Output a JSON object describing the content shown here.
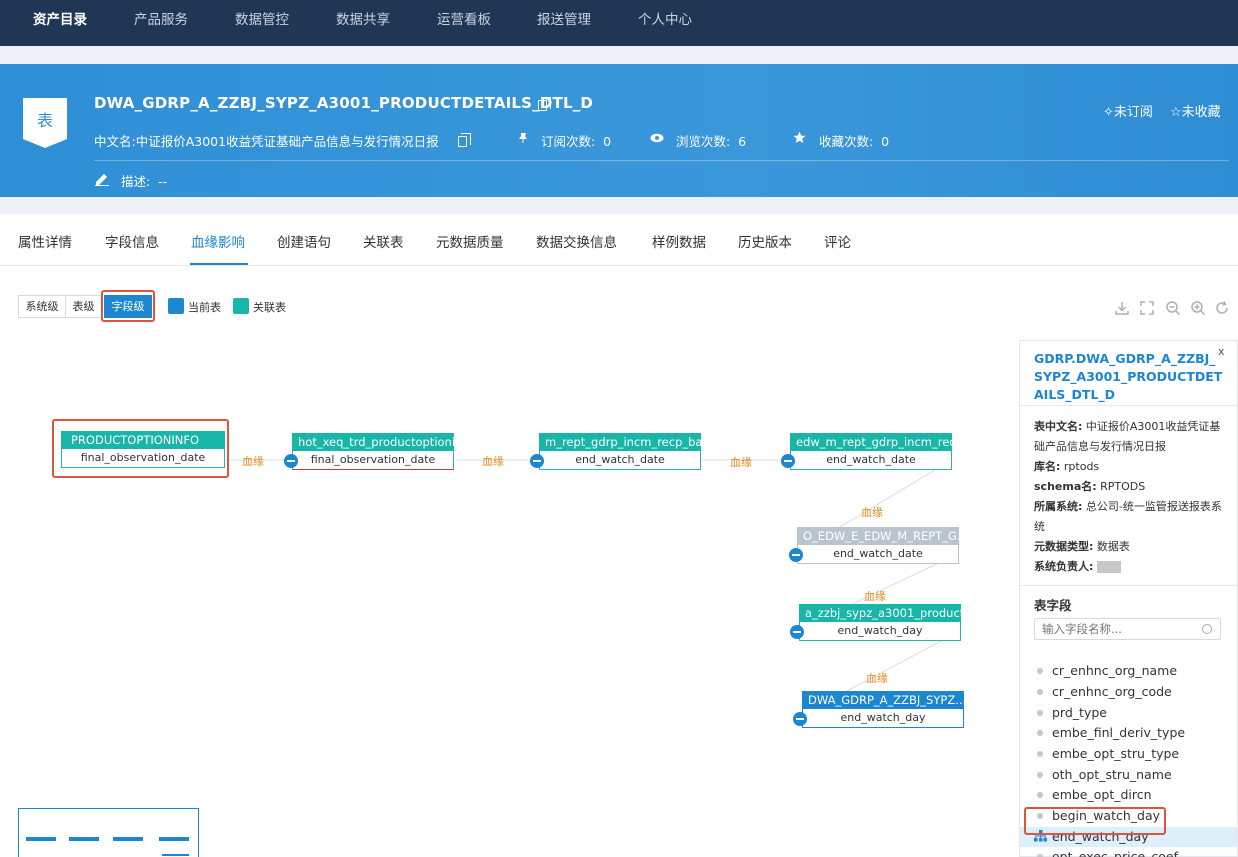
{
  "nav": {
    "items": [
      "资产目录",
      "产品服务",
      "数据管控",
      "数据共享",
      "运营看板",
      "报送管理",
      "个人中心"
    ],
    "active_index": 0
  },
  "header": {
    "icon_text": "表",
    "title": "DWA_GDRP_A_ZZBJ_SYPZ_A3001_PRODUCTDETAILS_DTL_D",
    "cn_name_label": "中文名:",
    "cn_name": "中证报价A3001收益凭证基础产品信息与发行情况日报",
    "subscribe_label": "订阅次数:",
    "subscribe_count": "0",
    "view_label": "浏览次数:",
    "view_count": "6",
    "fav_label": "收藏次数:",
    "fav_count": "0",
    "subscribe_btn": "未订阅",
    "fav_btn": "未收藏",
    "desc_label": "描述:",
    "desc_value": "--"
  },
  "tabs": [
    "属性详情",
    "字段信息",
    "血缘影响",
    "创建语句",
    "关联表",
    "元数据质量",
    "数据交换信息",
    "样例数据",
    "历史版本",
    "评论"
  ],
  "active_tab_index": 2,
  "levels": [
    "系统级",
    "表级",
    "字段级"
  ],
  "active_level_index": 2,
  "legend": {
    "current_label": "当前表",
    "current_color": "#1d86d0",
    "related_label": "关联表",
    "related_color": "#17b6a8"
  },
  "toolbar": [
    "download-icon",
    "fullscreen-icon",
    "zoom-out-icon",
    "zoom-in-icon",
    "refresh-icon"
  ],
  "edge_label": "血缘",
  "nodes": [
    {
      "table": "PRODUCTOPTIONINFO",
      "field": "final_observation_date",
      "kind": "teal"
    },
    {
      "table": "hot_xeq_trd_productoptioni...",
      "field": "final_observation_date",
      "kind": "teal"
    },
    {
      "table": "m_rept_gdrp_incm_recp_ba...",
      "field": "end_watch_date",
      "kind": "teal"
    },
    {
      "table": "edw_m_rept_gdrp_incm_rec...",
      "field": "end_watch_date",
      "kind": "teal"
    },
    {
      "table": "O_EDW_E_EDW_M_REPT_G...",
      "field": "end_watch_date",
      "kind": "grey"
    },
    {
      "table": "a_zzbj_sypz_a3001_product...",
      "field": "end_watch_day",
      "kind": "teal"
    },
    {
      "table": "DWA_GDRP_A_ZZBJ_SYPZ...",
      "field": "end_watch_day",
      "kind": "blue"
    }
  ],
  "detail": {
    "close": "x",
    "title": "GDRP.DWA_GDRP_A_ZZBJ_SYPZ_A3001_PRODUCTDETAILS_DTL_D",
    "cn_name_label": "表中文名:",
    "cn_name": "中证报价A3001收益凭证基础产品信息与发行情况日报",
    "db_label": "库名:",
    "db": "rptods",
    "schema_label": "schema名:",
    "schema": "RPTODS",
    "system_label": "所属系统:",
    "system": "总公司-统一监管报送报表系统",
    "meta_type_label": "元数据类型:",
    "meta_type": "数据表",
    "owner_label": "系统负责人:",
    "fields_heading": "表字段",
    "search_placeholder": "输入字段名称...",
    "fields": [
      "cr_enhnc_org_name",
      "cr_enhnc_org_code",
      "prd_type",
      "embe_finl_deriv_type",
      "embe_opt_stru_type",
      "oth_opt_stru_name",
      "embe_opt_dircn",
      "begin_watch_day",
      "end_watch_day",
      "opt_exec_price_coef"
    ],
    "selected_field_index": 8
  }
}
